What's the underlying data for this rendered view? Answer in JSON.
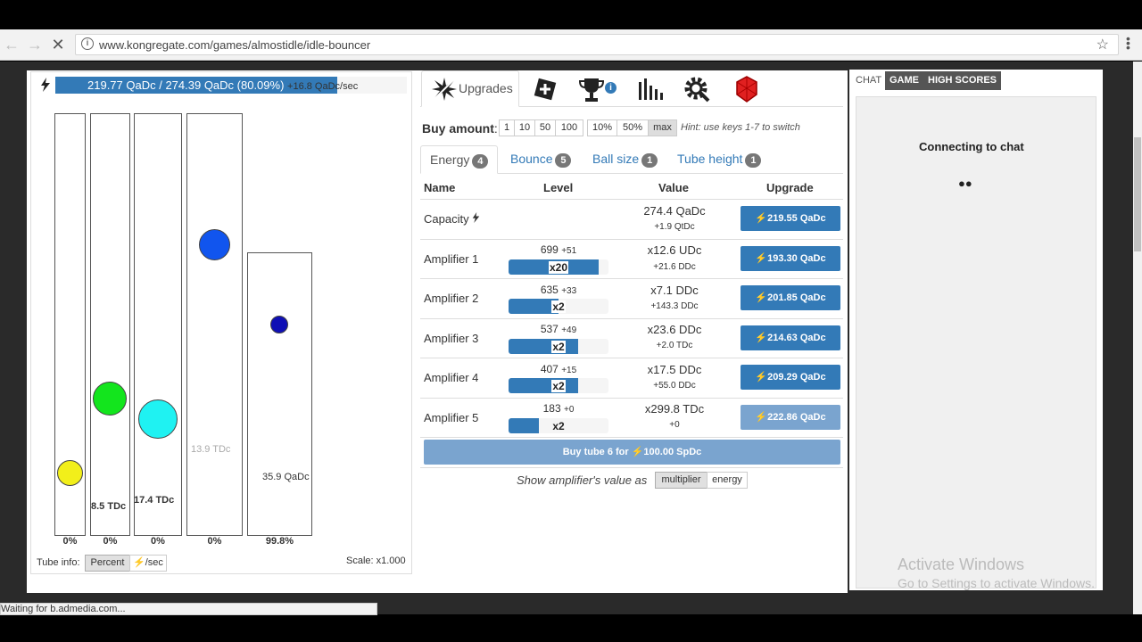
{
  "browser": {
    "url": "www.kongregate.com/games/almostidle/idle-bouncer",
    "info_icon": "i",
    "star_icon": "☆",
    "status_text": "Waiting for b.admedia.com..."
  },
  "energy": {
    "icon": "bolt-icon",
    "text": "219.77 QaDc / 274.39 QaDc (80.09%)",
    "rate": "+16.8 QaDc/sec",
    "fill_fraction": 0.8009
  },
  "tubes": [
    {
      "pct": "0%",
      "label": ""
    },
    {
      "pct": "0%",
      "label": "8.5 TDc"
    },
    {
      "pct": "0%",
      "label": "17.4 TDc"
    },
    {
      "pct": "0%",
      "label": "13.9 TDc"
    },
    {
      "pct": "99.8%",
      "label": "35.9 QaDc"
    }
  ],
  "tube_info": {
    "label": "Tube info:",
    "percent": "Percent",
    "per_sec": "/sec"
  },
  "scale": "Scale: x1.000",
  "tabs": {
    "upgrades": "Upgrades"
  },
  "buy": {
    "label": "Buy amount",
    "colon": ":",
    "options": [
      "1",
      "10",
      "50",
      "100",
      "10%",
      "50%",
      "max"
    ],
    "hint": "Hint: use keys 1-7 to switch"
  },
  "subtabs": [
    {
      "label": "Energy",
      "count": "4"
    },
    {
      "label": "Bounce",
      "count": "5"
    },
    {
      "label": "Ball size",
      "count": "1"
    },
    {
      "label": "Tube height",
      "count": "1"
    }
  ],
  "table": {
    "headers": {
      "name": "Name",
      "level": "Level",
      "value": "Value",
      "upgrade": "Upgrade"
    },
    "rows": [
      {
        "name": "Capacity",
        "level": "",
        "level_add": "",
        "mult": "",
        "fill": 0,
        "value": "274.4 QaDc",
        "value2": "+1.9 QtDc",
        "cost": "219.55 QaDc",
        "disabled": false
      },
      {
        "name": "Amplifier 1",
        "level": "699",
        "level_add": "+51",
        "mult": "x20",
        "fill": 0.9,
        "value": "x12.6 UDc",
        "value2": "+21.6 DDc",
        "cost": "193.30 QaDc",
        "disabled": false
      },
      {
        "name": "Amplifier 2",
        "level": "635",
        "level_add": "+33",
        "mult": "x2",
        "fill": 0.5,
        "value": "x7.1 DDc",
        "value2": "+143.3 DDc",
        "cost": "201.85 QaDc",
        "disabled": false
      },
      {
        "name": "Amplifier 3",
        "level": "537",
        "level_add": "+49",
        "mult": "x2",
        "fill": 0.7,
        "value": "x23.6 DDc",
        "value2": "+2.0 TDc",
        "cost": "214.63 QaDc",
        "disabled": false
      },
      {
        "name": "Amplifier 4",
        "level": "407",
        "level_add": "+15",
        "mult": "x2",
        "fill": 0.7,
        "value": "x17.5 DDc",
        "value2": "+55.0 DDc",
        "cost": "209.29 QaDc",
        "disabled": false
      },
      {
        "name": "Amplifier 5",
        "level": "183",
        "level_add": "+0",
        "mult": "x2",
        "fill": 0.3,
        "value": "x299.8 TDc",
        "value2": "+0",
        "cost": "222.86 QaDc",
        "disabled": true
      }
    ]
  },
  "buy_tube": "Buy tube 6 for ⚡100.00 SpDc",
  "show_value": {
    "label": "Show amplifier's value as",
    "multiplier": "multiplier",
    "energy": "energy"
  },
  "chat": {
    "tabs": [
      "CHAT",
      "GAME",
      "HIGH SCORES"
    ],
    "connecting": "Connecting to chat",
    "dots": "●●"
  },
  "windows": {
    "activate": "Activate Windows",
    "settings": "Go to Settings to activate Windows."
  },
  "colors": {
    "accent": "#337ab7",
    "accent_disabled": "#7aa4cf"
  }
}
